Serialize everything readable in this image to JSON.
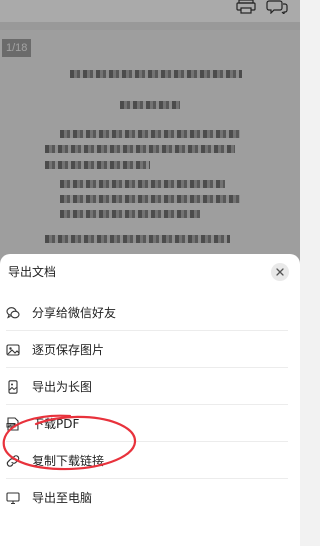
{
  "toolbar": {
    "print_icon": "printer-icon",
    "comment_icon": "comment-icon"
  },
  "preview": {
    "page_indicator": "1/18"
  },
  "export_sheet": {
    "title": "导出文档",
    "close_icon": "close-icon",
    "items": [
      {
        "label": "分享给微信好友",
        "icon": "wechat-icon"
      },
      {
        "label": "逐页保存图片",
        "icon": "image-icon"
      },
      {
        "label": "导出为长图",
        "icon": "long-image-icon"
      },
      {
        "label": "下载PDF",
        "icon": "pdf-icon"
      },
      {
        "label": "复制下载链接",
        "icon": "link-icon"
      },
      {
        "label": "导出至电脑",
        "icon": "monitor-icon"
      }
    ]
  },
  "highlight_color": "#e8323c"
}
